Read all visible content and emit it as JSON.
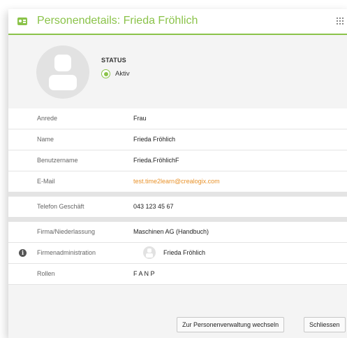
{
  "header": {
    "title": "Personendetails: Frieda Fröhlich",
    "accent_color": "#8bc34a",
    "icon": "contact-card-icon",
    "menu_icon": "grip-icon"
  },
  "profile": {
    "avatar_icon": "user-avatar-icon",
    "status_label": "STATUS",
    "status_value": "Aktiv"
  },
  "details": {
    "anrede": {
      "label": "Anrede",
      "value": "Frau"
    },
    "name": {
      "label": "Name",
      "value": "Frieda Fröhlich"
    },
    "benutzername": {
      "label": "Benutzername",
      "value": "Frieda.FröhlichF"
    },
    "email": {
      "label": "E-Mail",
      "value": "test.time2learn@crealogix.com",
      "link_color": "#e8922a"
    },
    "telefon": {
      "label": "Telefon Geschäft",
      "value": "043 123 45 67"
    },
    "firma": {
      "label": "Firma/Niederlassung",
      "value": "Maschinen AG (Handbuch)"
    },
    "firmenadmin": {
      "label": "Firmenadministration",
      "value": "Frieda Fröhlich",
      "icon": "info-icon"
    },
    "rollen": {
      "label": "Rollen",
      "value": "F A N P"
    }
  },
  "footer": {
    "switch_label": "Zur Personenverwaltung wechseln",
    "close_label": "Schliessen"
  }
}
